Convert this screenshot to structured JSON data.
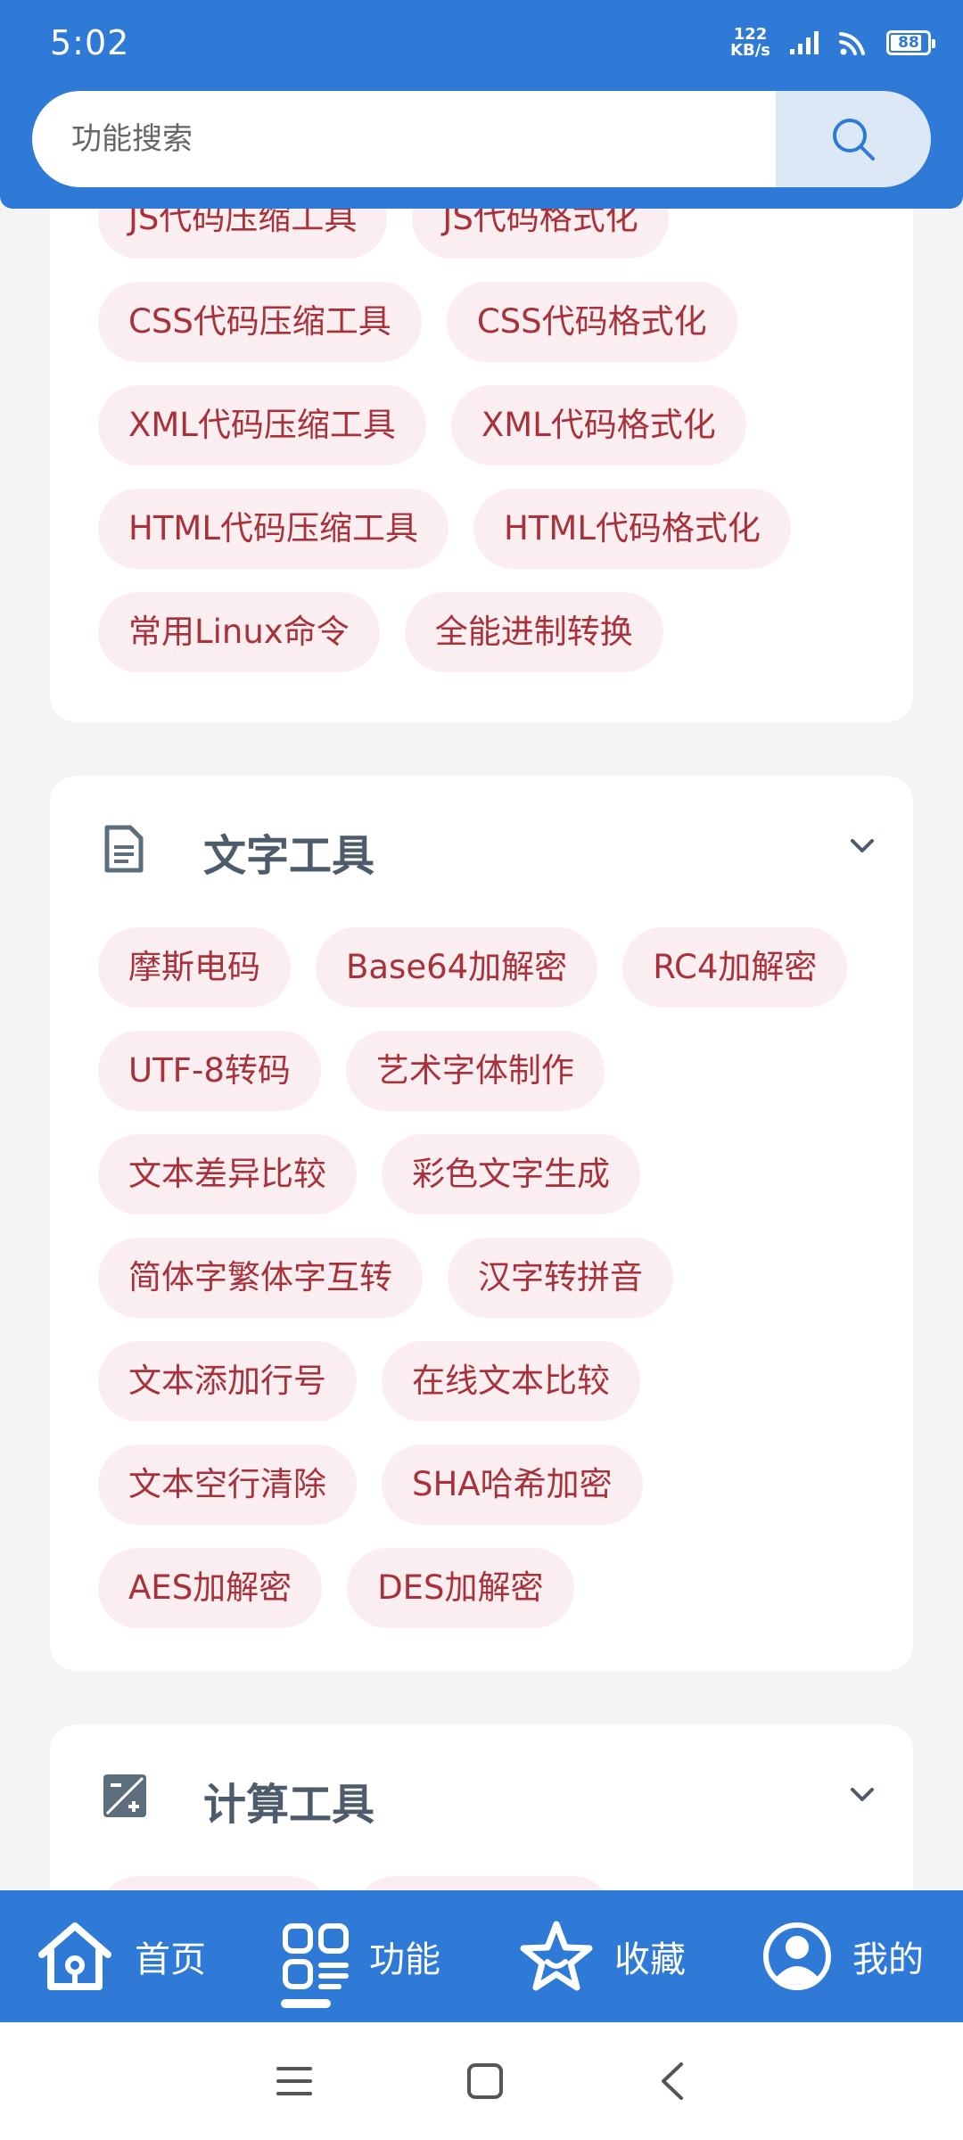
{
  "status_bar": {
    "time": "5:02",
    "net_speed_value": "122",
    "net_speed_unit": "KB/s",
    "battery": "88"
  },
  "search": {
    "placeholder": "功能搜索"
  },
  "card_top": {
    "chips": [
      "JS代码压缩工具",
      "JS代码格式化",
      "CSS代码压缩工具",
      "CSS代码格式化",
      "XML代码压缩工具",
      "XML代码格式化",
      "HTML代码压缩工具",
      "HTML代码格式化",
      "常用Linux命令",
      "全能进制转换"
    ]
  },
  "card_text": {
    "title": "文字工具",
    "chips": [
      "摩斯电码",
      "Base64加解密",
      "RC4加解密",
      "UTF-8转码",
      "艺术字体制作",
      "文本差异比较",
      "彩色文字生成",
      "简体字繁体字互转",
      "汉字转拼音",
      "文本添加行号",
      "在线文本比较",
      "文本空行清除",
      "SHA哈希加密",
      "AES加解密",
      "DES加解密"
    ]
  },
  "card_calc": {
    "title": "计算工具"
  },
  "bottom_nav": {
    "items": [
      {
        "label": "首页",
        "icon": "home-icon"
      },
      {
        "label": "功能",
        "icon": "grid-list-icon"
      },
      {
        "label": "收藏",
        "icon": "star-icon"
      },
      {
        "label": "我的",
        "icon": "user-icon"
      }
    ],
    "active": 1
  },
  "colors": {
    "primary": "#2f7ad6",
    "chip_bg": "#fbeef0",
    "chip_text": "#a8323c"
  }
}
